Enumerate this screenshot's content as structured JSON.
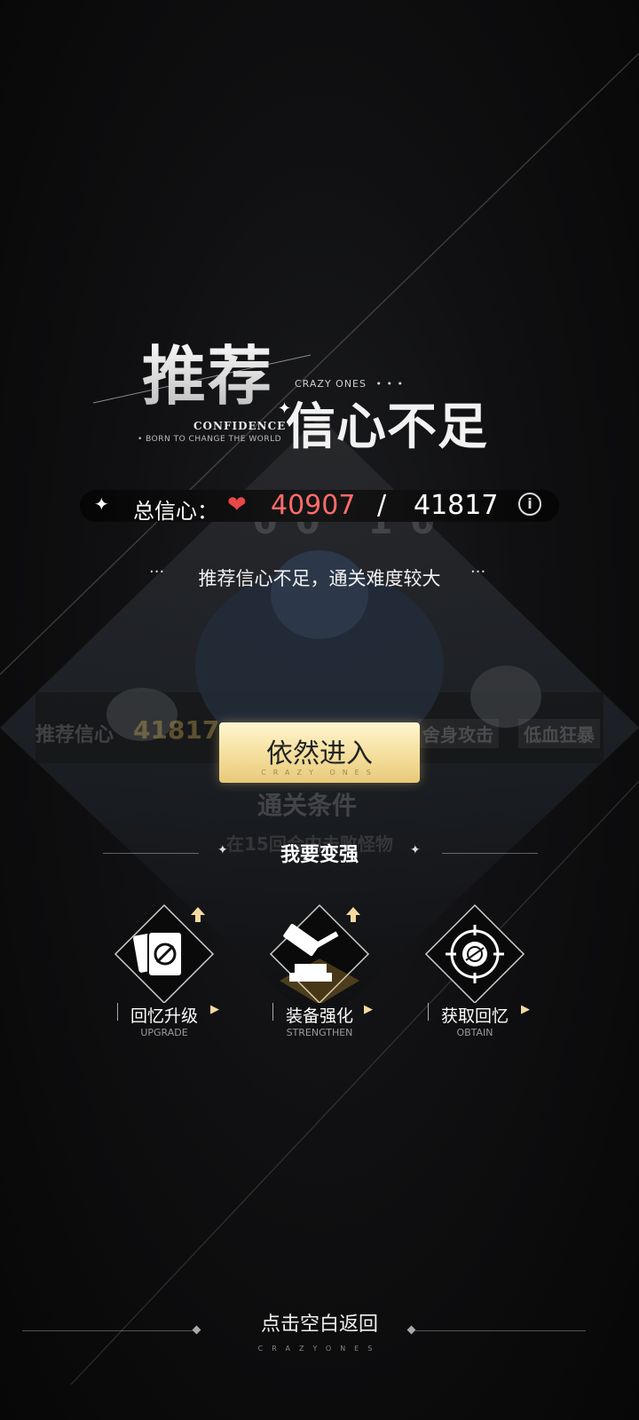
{
  "header": {
    "title_main": "推荐",
    "title_sub": "信心不足",
    "brand_small": "CRAZY ONES",
    "brand_dots": "• • •",
    "confidence_word": "CONFIDENCE",
    "slogan": "• BORN TO CHANGE THE WORLD"
  },
  "confidence": {
    "label": "总信心：",
    "current": "40907",
    "separator": "/",
    "total": "41817",
    "current_color": "#ff6b6b"
  },
  "warning": {
    "text": "推荐信心不足，通关难度较大"
  },
  "background_card": {
    "timer": "00 10",
    "recommend_label": "推荐信心",
    "recommend_value": "41817",
    "tag1": "舍身攻击",
    "tag2": "低血狂暴",
    "condition_title": "通关条件",
    "condition_text": "在15回合内击败怪物"
  },
  "enter_button": {
    "label": "依然进入",
    "sublabel": "CRAZY ONES"
  },
  "strengthen": {
    "title": "我要变强",
    "items": [
      {
        "label": "回忆升级",
        "sub": "UPGRADE",
        "icon": "card-upgrade-icon"
      },
      {
        "label": "装备强化",
        "sub": "STRENGTHEN",
        "icon": "hammer-icon"
      },
      {
        "label": "获取回忆",
        "sub": "OBTAIN",
        "icon": "target-icon"
      }
    ]
  },
  "footer": {
    "return_label": "点击空白返回",
    "brand": "CRAZYONES"
  },
  "colors": {
    "accent_gold": "#f3dc98",
    "upgrade_arrow": "#f5d9a0"
  }
}
